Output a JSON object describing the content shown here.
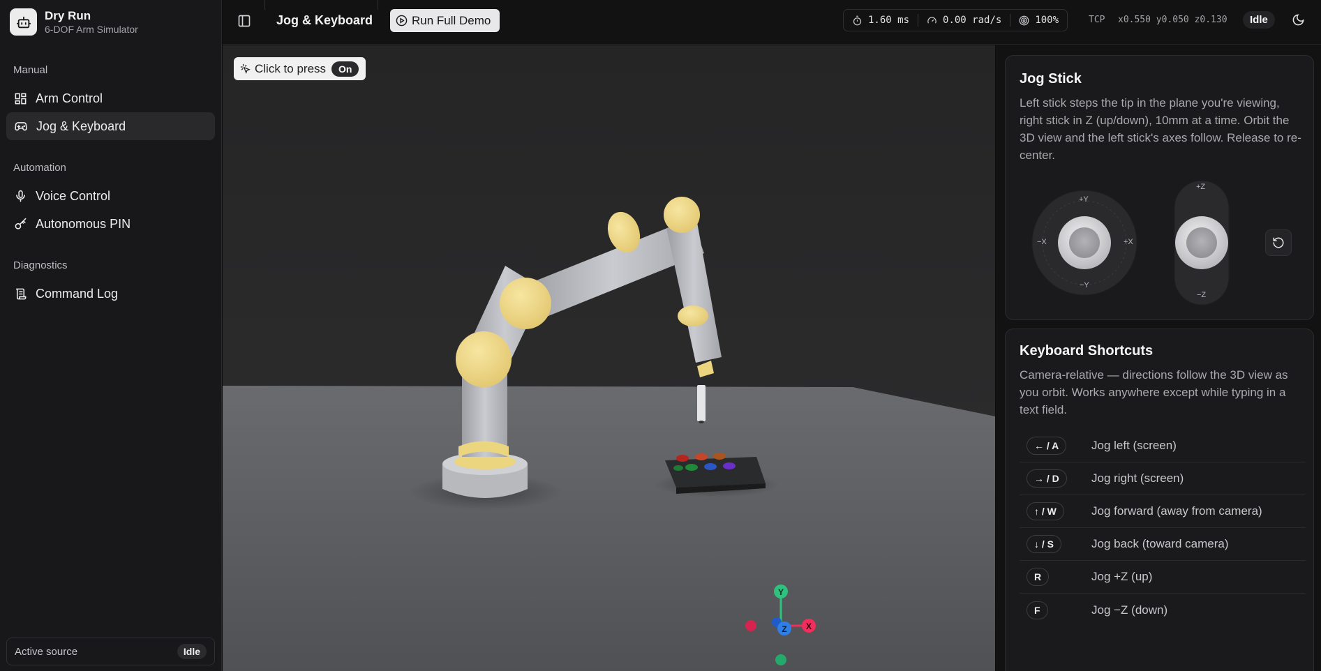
{
  "app": {
    "title": "Dry Run",
    "subtitle": "6-DOF Arm Simulator"
  },
  "sidebar": {
    "sections": [
      {
        "label": "Manual",
        "items": [
          {
            "label": "Arm Control",
            "icon": "dashboard-icon",
            "active": false
          },
          {
            "label": "Jog & Keyboard",
            "icon": "gamepad-icon",
            "active": true
          }
        ]
      },
      {
        "label": "Automation",
        "items": [
          {
            "label": "Voice Control",
            "icon": "microphone-icon",
            "active": false
          },
          {
            "label": "Autonomous PIN",
            "icon": "key-icon",
            "active": false
          }
        ]
      },
      {
        "label": "Diagnostics",
        "items": [
          {
            "label": "Command Log",
            "icon": "scroll-icon",
            "active": false
          }
        ]
      }
    ],
    "footer": {
      "label": "Active source",
      "value": "Idle"
    }
  },
  "topbar": {
    "page_title": "Jog & Keyboard",
    "demo_button": "Run Full Demo",
    "stats": {
      "latency": "1.60 ms",
      "velocity": "0.00 rad/s",
      "speed": "100%"
    },
    "tcp_label": "TCP",
    "tcp_value": "x0.550 y0.050 z0.130",
    "status": "Idle"
  },
  "viewport": {
    "press_chip": {
      "label": "Click to press",
      "toggle": "On"
    },
    "gizmo": {
      "x": "X",
      "y": "Y",
      "z": "Z"
    }
  },
  "jog_stick": {
    "title": "Jog Stick",
    "description": "Left stick steps the tip in the plane you're viewing, right stick in Z (up/down), 10mm at a time. Orbit the 3D view and the left stick's axes follow. Release to re-center.",
    "left_axes": {
      "top": "+Y",
      "bottom": "−Y",
      "left": "−X",
      "right": "+X"
    },
    "right_axes": {
      "top": "+Z",
      "bottom": "−Z"
    }
  },
  "keyboard": {
    "title": "Keyboard Shortcuts",
    "description": "Camera-relative — directions follow the 3D view as you orbit. Works anywhere except while typing in a text field.",
    "shortcuts": [
      {
        "key": "← / A",
        "desc": "Jog left (screen)"
      },
      {
        "key": "→ / D",
        "desc": "Jog right (screen)"
      },
      {
        "key": "↑ / W",
        "desc": "Jog forward (away from camera)"
      },
      {
        "key": "↓ / S",
        "desc": "Jog back (toward camera)"
      },
      {
        "key": "R",
        "desc": "Jog +Z (up)"
      },
      {
        "key": "F",
        "desc": "Jog −Z (down)"
      }
    ]
  },
  "colors": {
    "accent_yellow": "#f2dc8a",
    "arm_grey": "#bfc1c6",
    "floor": "#5f6064",
    "sky": "#2b2b2c",
    "gizmo_x": "#ef2e5b",
    "gizmo_y": "#2ec27e",
    "gizmo_z": "#2f7fe6"
  }
}
